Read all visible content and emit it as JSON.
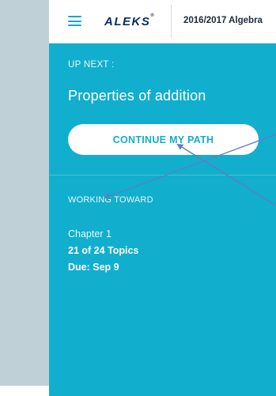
{
  "header": {
    "logo_text": "ALEKS",
    "logo_mark": "®",
    "course_name": "2016/2017 Algebra",
    "menu_icon": "hamburger-menu-icon"
  },
  "up_next": {
    "label": "UP NEXT :",
    "topic": "Properties of addition",
    "button_label": "CONTINUE MY PATH"
  },
  "working_toward": {
    "label": "WORKING TOWARD",
    "chapter": "Chapter 1",
    "topics": "21 of 24 Topics",
    "due": "Due: Sep 9"
  },
  "colors": {
    "panel": "#12aecd",
    "rail": "#bfd1d6",
    "logo": "#0a2d5a",
    "annotation_arrow": "#5b7fc4"
  }
}
